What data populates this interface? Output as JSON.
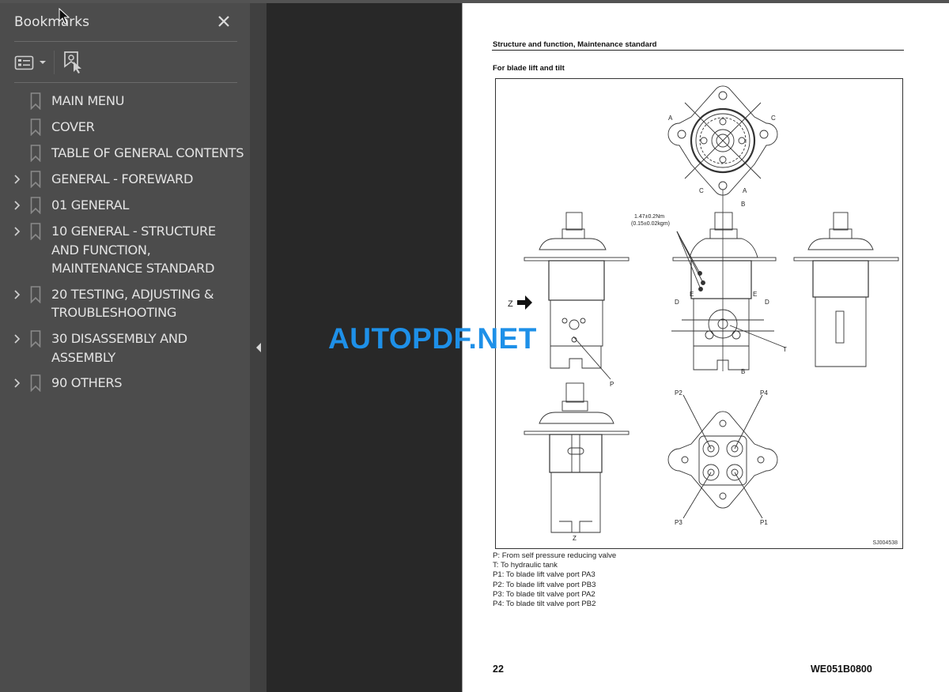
{
  "bookmarks_panel": {
    "title": "Bookmarks",
    "close_icon": "close-icon",
    "options_icon": "list-options-icon",
    "find_icon": "find-bookmark-icon",
    "items": [
      {
        "label": "MAIN MENU",
        "expandable": false
      },
      {
        "label": "COVER",
        "expandable": false
      },
      {
        "label": "TABLE OF GENERAL CONTENTS",
        "expandable": false
      },
      {
        "label": "GENERAL - FOREWARD",
        "expandable": true
      },
      {
        "label": "01 GENERAL",
        "expandable": true
      },
      {
        "label": "10 GENERAL - STRUCTURE AND FUNCTION, MAINTENANCE STANDARD",
        "expandable": true
      },
      {
        "label": "20 TESTING, ADJUSTING & TROUBLESHOOTING",
        "expandable": true
      },
      {
        "label": "30 DISASSEMBLY AND ASSEMBLY",
        "expandable": true
      },
      {
        "label": "90 OTHERS",
        "expandable": true
      }
    ]
  },
  "document": {
    "header": "Structure and function, Maintenance standard",
    "subheading": "For blade lift and tilt",
    "figure": {
      "id": "SJ004538",
      "torque_line1": "1.47±0.2Nm",
      "torque_line2": "(0.15±0.02kgm)",
      "labels": {
        "A": "A",
        "B": "B",
        "C": "C",
        "D": "D",
        "E": "E",
        "P": "P",
        "T": "T",
        "Z": "Z",
        "P1": "P1",
        "P2": "P2",
        "P3": "P3",
        "P4": "P4"
      }
    },
    "legend": [
      "P: From self pressure reducing valve",
      "T: To hydraulic tank",
      "P1: To blade lift valve port PA3",
      "P2: To blade lift valve port PB3",
      "P3: To blade tilt valve port PA2",
      "P4: To blade tilt valve port PB2"
    ],
    "page_number": "22",
    "doc_code": "WE051B0800"
  },
  "watermark": "AUTOPDF.NET",
  "colors": {
    "panel_bg": "#4c4c4c",
    "viewer_bg": "#282828",
    "watermark": "#1e90e8"
  }
}
